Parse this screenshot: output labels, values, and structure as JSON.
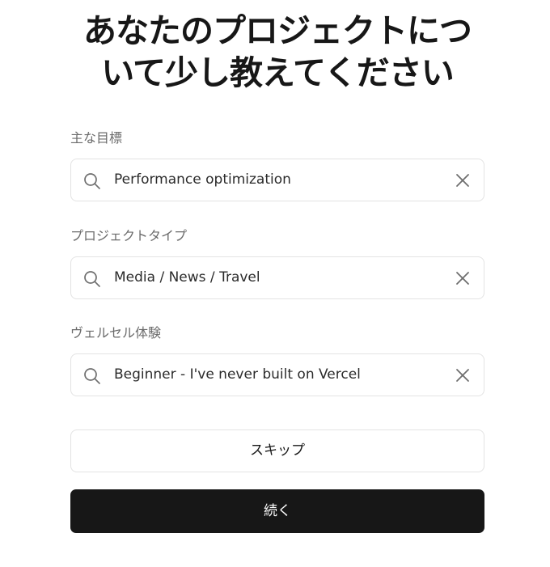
{
  "header": {
    "title_line1": "あなたのプロジェクトにつ",
    "title_line2": "いて少し教えてください"
  },
  "form": {
    "fields": [
      {
        "label": "主な目標",
        "value": "Performance optimization",
        "search_icon": "search-icon",
        "clear_icon": "close-icon"
      },
      {
        "label": "プロジェクトタイプ",
        "value": "Media / News / Travel",
        "search_icon": "search-icon",
        "clear_icon": "close-icon"
      },
      {
        "label": "ヴェルセル体験",
        "value": "Beginner - I've never built on Vercel",
        "search_icon": "search-icon",
        "clear_icon": "close-icon"
      }
    ]
  },
  "actions": {
    "skip_label": "スキップ",
    "continue_label": "続く"
  },
  "colors": {
    "primary": "#171717",
    "border": "#e3e3e3",
    "label": "#6b6b6b",
    "icon": "#6e6e6e"
  }
}
